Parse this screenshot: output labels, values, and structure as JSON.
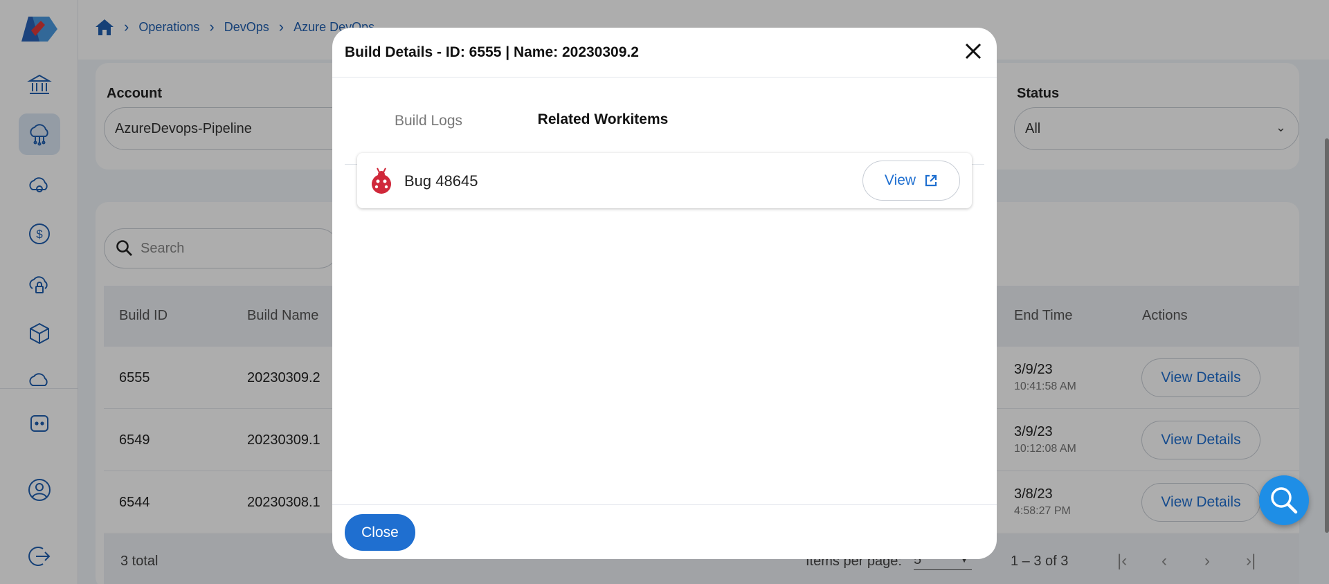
{
  "breadcrumb": {
    "items": [
      "Operations",
      "DevOps",
      "Azure DevOps"
    ]
  },
  "filters": {
    "account_label": "Account",
    "account_value": "AzureDevops-Pipeline",
    "status_label": "Status",
    "status_value": "All"
  },
  "search": {
    "placeholder": "Search"
  },
  "table": {
    "headers": [
      "Build ID",
      "Build Name",
      "End Time",
      "Actions"
    ],
    "rows": [
      {
        "id": "6555",
        "name": "20230309.2",
        "date": "3/9/23",
        "time": "10:41:58 AM",
        "action": "View Details"
      },
      {
        "id": "6549",
        "name": "20230309.1",
        "date": "3/9/23",
        "time": "10:12:08 AM",
        "action": "View Details"
      },
      {
        "id": "6544",
        "name": "20230308.1",
        "date": "3/8/23",
        "time": "4:58:27 PM",
        "action": "View Details"
      }
    ],
    "total": "3 total",
    "items_per_page_label": "Items per page:",
    "items_per_page_value": "5",
    "range": "1 – 3 of 3"
  },
  "modal": {
    "title": "Build Details - ID: 6555 | Name: 20230309.2",
    "tabs": [
      "Build Logs",
      "Related Workitems"
    ],
    "workitem_label": "Bug 48645",
    "view_label": "View",
    "close_label": "Close"
  },
  "colors": {
    "accent": "#1f6fd0",
    "bug": "#d0283a",
    "fab": "#1e8ee6"
  },
  "icons": {
    "sidebar": [
      "bank-icon",
      "cloud-network-icon",
      "cloud-gear-icon",
      "dollar-icon",
      "cloud-lock-icon",
      "cube-icon",
      "cloud-settings-icon",
      "chat-bot-icon",
      "user-circle-icon",
      "logout-icon"
    ]
  }
}
